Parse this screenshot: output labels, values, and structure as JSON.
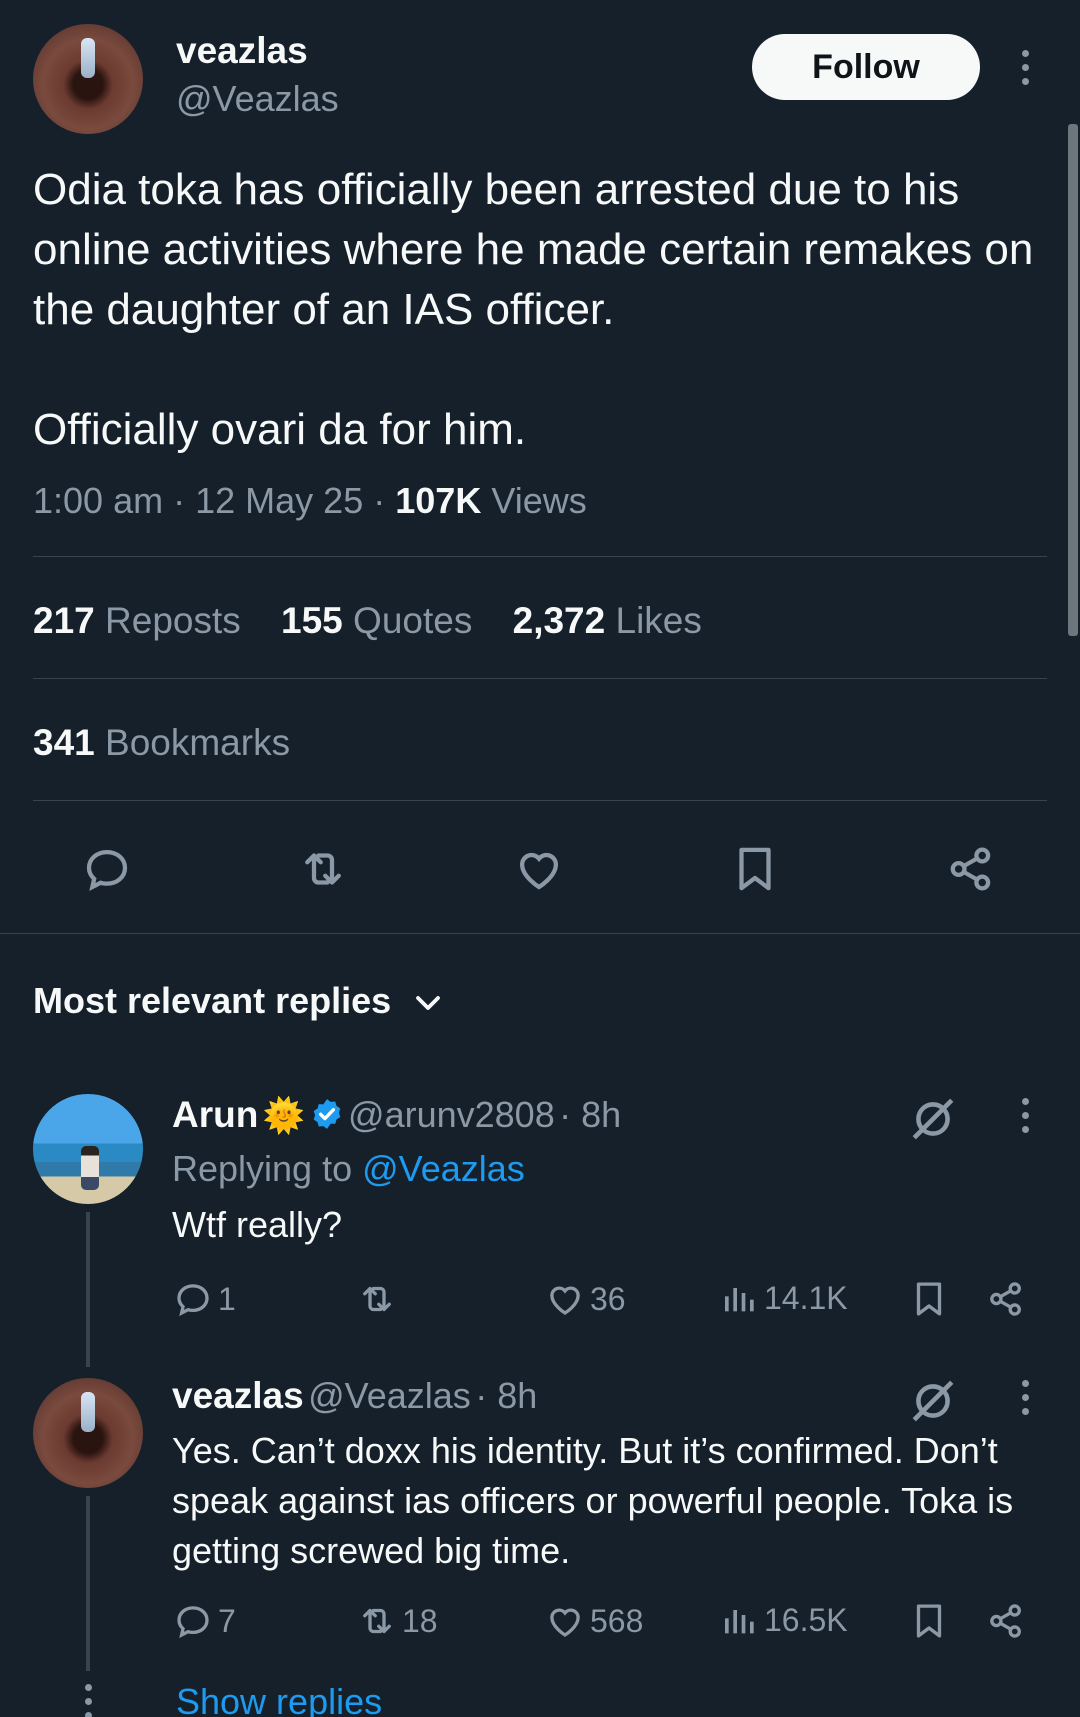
{
  "tweet": {
    "author_name": "veazlas",
    "author_handle": "@Veazlas",
    "follow_label": "Follow",
    "text": "Odia toka has officially been arrested due to his online activities where he made certain remakes on the daughter of an IAS officer.\n\nOfficially ovari da for him.",
    "time": "1:00 am",
    "date": "12 May 25",
    "views_count": "107K",
    "views_label": "Views",
    "sep": "·",
    "reposts_count": "217",
    "reposts_label": "Reposts",
    "quotes_count": "155",
    "quotes_label": "Quotes",
    "likes_count": "2,372",
    "likes_label": "Likes",
    "bookmarks_count": "341",
    "bookmarks_label": "Bookmarks"
  },
  "replies_header": "Most relevant replies",
  "replies": [
    {
      "name": "Arun",
      "emoji": "🌞",
      "handle": "@arunv2808",
      "time": "· 8h",
      "replying_prefix": "Replying to",
      "replying_to": "@Veazlas",
      "text": "Wtf really?",
      "comments": "1",
      "reposts": "",
      "likes": "36",
      "views": "14.1K"
    },
    {
      "name": "veazlas",
      "handle": "@Veazlas",
      "time": "· 8h",
      "text": "Yes. Can’t doxx his identity. But it’s confirmed. Don’t speak against ias officers or powerful people. Toka is getting screwed big time.",
      "comments": "7",
      "reposts": "18",
      "likes": "568",
      "views": "16.5K"
    }
  ],
  "show_replies_label": "Show replies",
  "colors": {
    "background": "#15202b",
    "text": "#f7f9f9",
    "muted": "#8b98a5",
    "accent": "#1d9bf0",
    "divider": "#38444d"
  }
}
